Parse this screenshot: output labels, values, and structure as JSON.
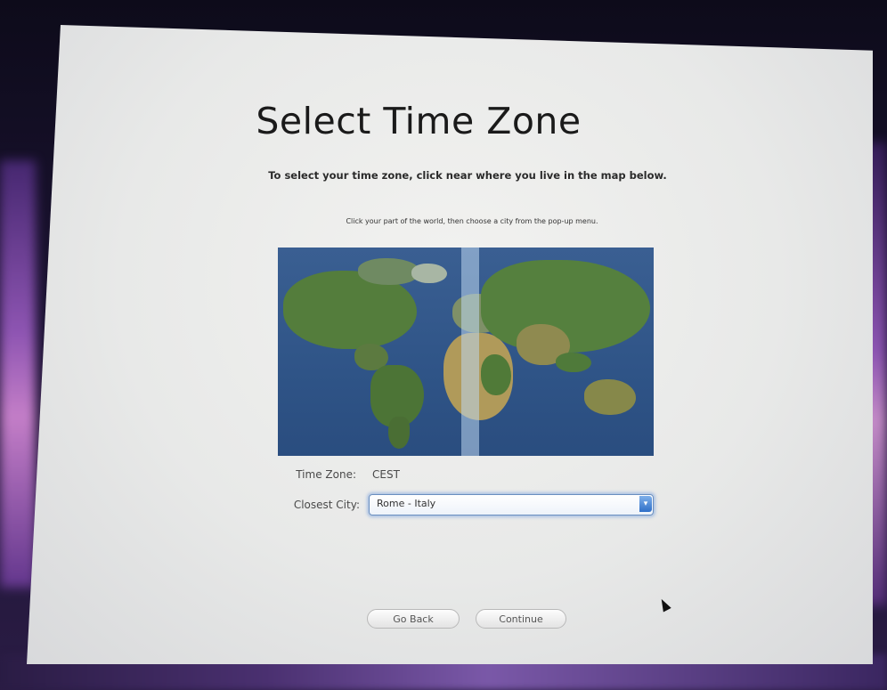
{
  "setup": {
    "title": "Select Time Zone",
    "subtitle": "To select your time zone, click near where you live in the map below.",
    "hint": "Click your part of the world, then choose a city from the pop-up menu.",
    "time_zone_label": "Time Zone:",
    "time_zone_value": "CEST",
    "closest_city_label": "Closest City:",
    "closest_city_value": "Rome - Italy",
    "go_back_label": "Go Back",
    "continue_label": "Continue"
  },
  "icons": {
    "dropdown_arrow": "chevron-down-icon",
    "cursor": "mouse-pointer-icon"
  },
  "colors": {
    "ocean": "#2f5487",
    "selected_band": "#bed7f0",
    "select_focus": "#6a8fbf"
  }
}
